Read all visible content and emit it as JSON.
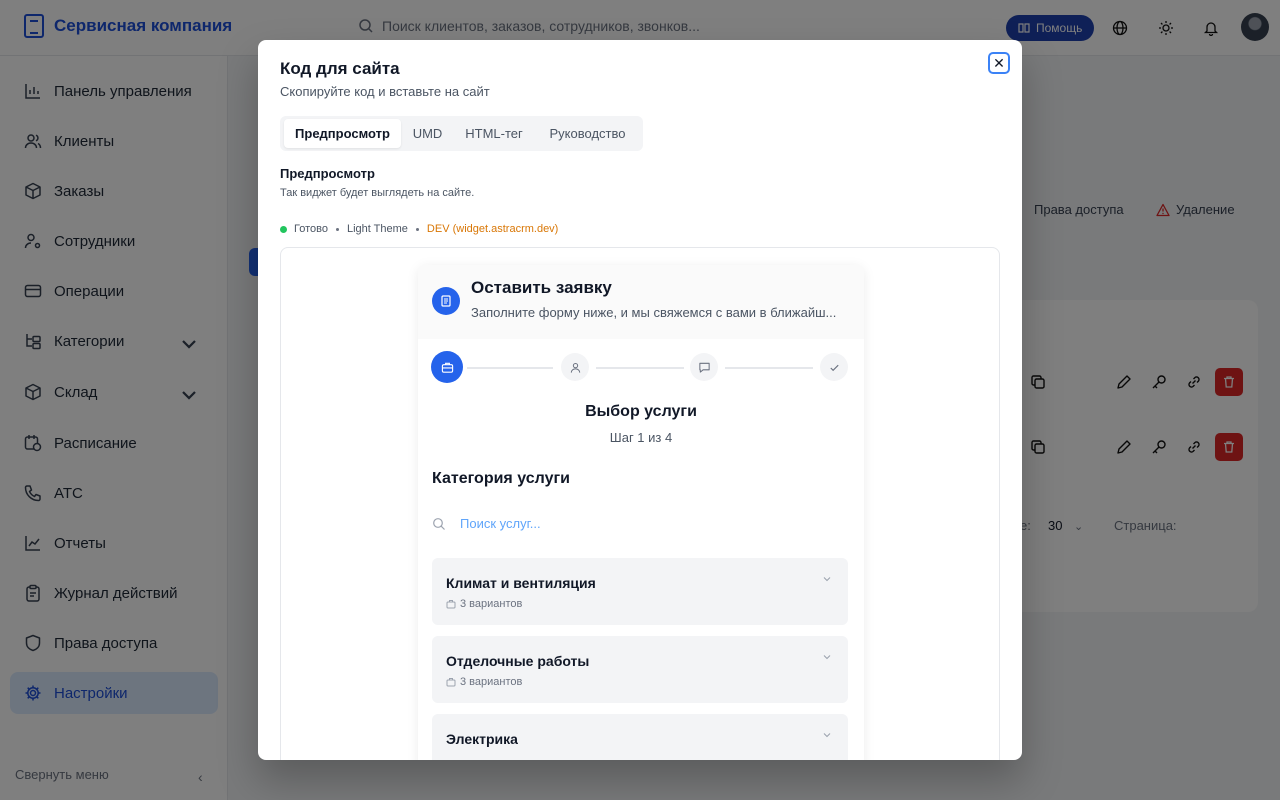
{
  "app": {
    "brand": "Сервисная компания",
    "search_placeholder": "Поиск клиентов, заказов, сотрудников, звонков...",
    "help_label": "Помощь"
  },
  "sidebar": {
    "items": [
      {
        "label": "Панель управления",
        "icon": "chart-bar-icon"
      },
      {
        "label": "Клиенты",
        "icon": "users-icon"
      },
      {
        "label": "Заказы",
        "icon": "box-icon"
      },
      {
        "label": "Сотрудники",
        "icon": "user-gear-icon"
      },
      {
        "label": "Операции",
        "icon": "card-icon"
      },
      {
        "label": "Категории",
        "icon": "tree-icon",
        "has_chevron": true
      },
      {
        "label": "Склад",
        "icon": "box-icon",
        "has_chevron": true
      },
      {
        "label": "Расписание",
        "icon": "calendar-clock-icon"
      },
      {
        "label": "АТС",
        "icon": "phone-icon"
      },
      {
        "label": "Отчеты",
        "icon": "line-chart-icon"
      },
      {
        "label": "Журнал действий",
        "icon": "clipboard-icon"
      },
      {
        "label": "Права доступа",
        "icon": "shield-icon"
      },
      {
        "label": "Настройки",
        "icon": "gear-icon",
        "active": true
      }
    ],
    "collapse_label": "Свернуть меню"
  },
  "background": {
    "tab_permissions": "Права доступа",
    "tab_delete": "Удаление",
    "per_page_label": "е:",
    "per_page_value": "30",
    "page_label": "Страница:"
  },
  "modal": {
    "title": "Код для сайта",
    "subtitle": "Скопируйте код и вставьте на сайт",
    "tabs": [
      {
        "label": "Предпросмотр",
        "active": true
      },
      {
        "label": "UMD"
      },
      {
        "label": "HTML-тег"
      },
      {
        "label": "Руководство"
      }
    ],
    "section_title": "Предпросмотр",
    "section_desc": "Так виджет будет выглядеть на сайте.",
    "status": {
      "ready": "Готово",
      "theme": "Light Theme",
      "env": "DEV (widget.astracrm.dev)"
    }
  },
  "widget": {
    "title": "Оставить заявку",
    "subtitle": "Заполните форму ниже, и мы свяжемся с вами в ближайш...",
    "steps": [
      "briefcase-icon",
      "user-icon",
      "message-icon",
      "check-icon"
    ],
    "step_title": "Выбор услуги",
    "step_count": "Шаг 1 из 4",
    "category_title": "Категория услуги",
    "search_placeholder": "Поиск услуг...",
    "categories": [
      {
        "name": "Климат и вентиляция",
        "meta": "3 вариантов"
      },
      {
        "name": "Отделочные работы",
        "meta": "3 вариантов"
      },
      {
        "name": "Электрика",
        "meta": ""
      }
    ]
  },
  "colors": {
    "accent": "#2563eb",
    "brand": "#1d4ed8",
    "ready": "#22c55e",
    "dev": "#d97706",
    "danger": "#dc2626"
  }
}
